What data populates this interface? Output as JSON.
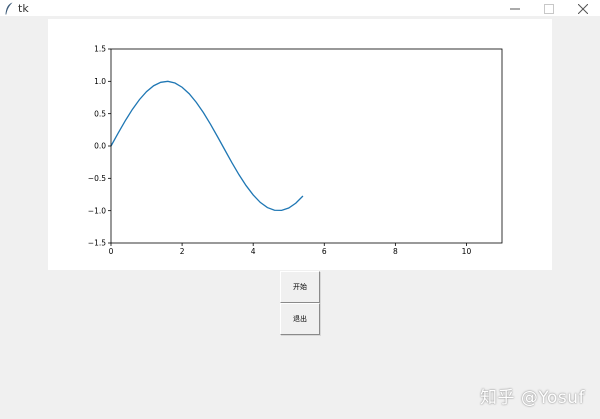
{
  "window": {
    "title": "tk",
    "icon": "feather-icon",
    "controls": [
      "minimize-icon",
      "maximize-icon",
      "close-icon"
    ]
  },
  "buttons": {
    "start_label": "开始",
    "exit_label": "退出"
  },
  "watermark": {
    "text": "知乎 @Yosuf"
  },
  "chart_data": {
    "type": "line",
    "title": "",
    "xlabel": "",
    "ylabel": "",
    "xlim": [
      0,
      11
    ],
    "ylim": [
      -1.5,
      1.5
    ],
    "xticks": [
      0,
      2,
      4,
      6,
      8,
      10
    ],
    "yticks": [
      -1.5,
      -1.0,
      -0.5,
      0.0,
      0.5,
      1.0,
      1.5
    ],
    "xtick_labels": [
      "0",
      "2",
      "4",
      "6",
      "8",
      "10"
    ],
    "ytick_labels": [
      "−1.5",
      "−1.0",
      "−0.5",
      "0.0",
      "0.5",
      "1.0",
      "1.5"
    ],
    "grid": false,
    "series": [
      {
        "color": "#1f77b4",
        "x": [
          0,
          0.2,
          0.4,
          0.6,
          0.8,
          1.0,
          1.2,
          1.4,
          1.6,
          1.8,
          2.0,
          2.2,
          2.4,
          2.6,
          2.8,
          3.0,
          3.2,
          3.4,
          3.6,
          3.8,
          4.0,
          4.2,
          4.4,
          4.6,
          4.8,
          5.0,
          5.2,
          5.4
        ],
        "y": [
          0.0,
          0.199,
          0.389,
          0.565,
          0.717,
          0.841,
          0.932,
          0.985,
          1.0,
          0.974,
          0.909,
          0.808,
          0.675,
          0.516,
          0.335,
          0.141,
          -0.058,
          -0.256,
          -0.443,
          -0.612,
          -0.757,
          -0.872,
          -0.952,
          -0.994,
          -0.996,
          -0.959,
          -0.883,
          -0.773
        ]
      }
    ]
  }
}
